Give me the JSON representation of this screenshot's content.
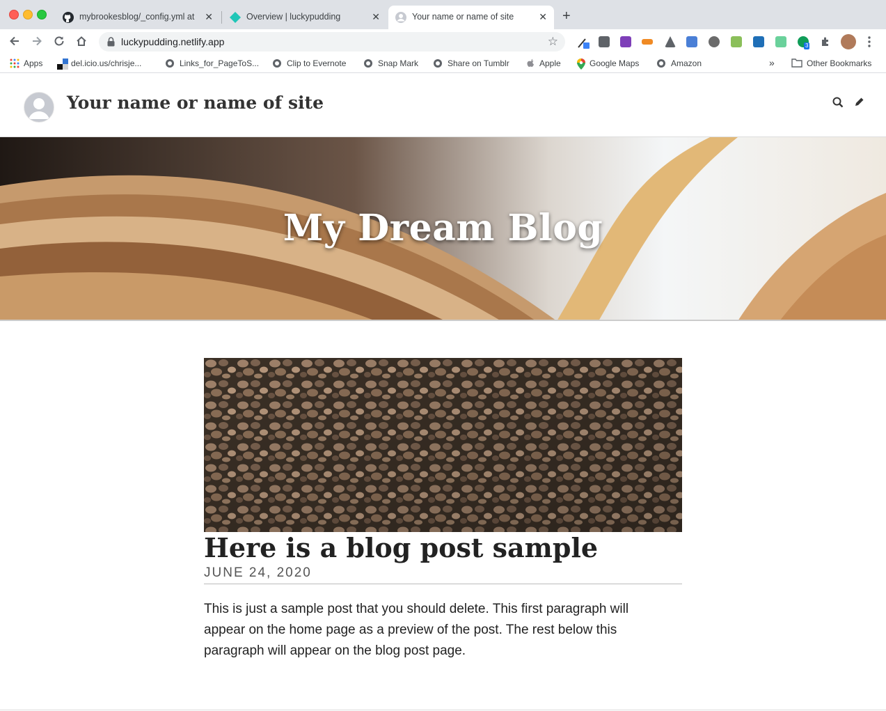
{
  "browser": {
    "tabs": [
      {
        "title": "mybrookesblog/_config.yml at",
        "icon": "github-icon"
      },
      {
        "title": "Overview | luckypudding",
        "icon": "netlify-icon"
      },
      {
        "title": "Your name or name of site",
        "icon": "avatar-icon",
        "active": true
      }
    ],
    "close_glyph": "✕",
    "new_tab_glyph": "+",
    "url": "luckypudding.netlify.app",
    "bookmarks": [
      {
        "label": "Apps",
        "icon": "apps-grid-icon"
      },
      {
        "label": "del.icio.us/chrisje...",
        "icon": "delicious-icon"
      },
      {
        "label": "Links_for_PageToS...",
        "icon": "globe-icon"
      },
      {
        "label": "Clip to Evernote",
        "icon": "globe-icon"
      },
      {
        "label": "Snap Mark",
        "icon": "globe-icon"
      },
      {
        "label": "Share on Tumblr",
        "icon": "globe-icon"
      },
      {
        "label": "Apple",
        "icon": "apple-icon"
      },
      {
        "label": "Google Maps",
        "icon": "google-maps-icon"
      },
      {
        "label": "Amazon",
        "icon": "globe-icon"
      }
    ],
    "overflow_glyph": "»",
    "other_bookmarks": "Other Bookmarks",
    "extension_badge": "3"
  },
  "site": {
    "title": "Your name or name of site",
    "hero_title": "My Dream Blog"
  },
  "post": {
    "title": "Here is a blog post sample",
    "date": "June 24, 2020",
    "excerpt": "This is just a sample post that you should delete. This first paragraph will appear on the home page as a preview of the post. The rest below this paragraph will appear on the blog post page."
  }
}
